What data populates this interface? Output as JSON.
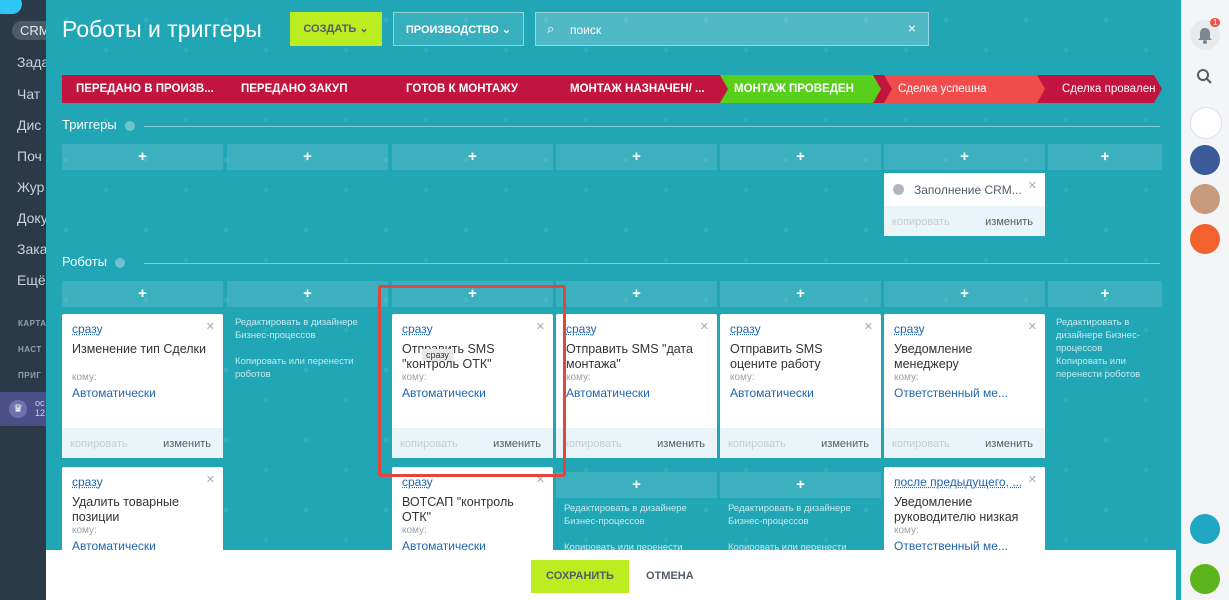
{
  "nav": {
    "pill": "CRM",
    "items": [
      "Зада",
      "Чат",
      "Дис",
      "Поч",
      "Жур",
      "Доку",
      "Зака",
      "Ещё"
    ],
    "small": [
      "КАРТА",
      "НАСТ",
      "ПРИГ"
    ],
    "user": {
      "line1": "ос",
      "line2": "12"
    }
  },
  "header": {
    "title": "Роботы и триггеры",
    "create_label": "СОЗДАТЬ",
    "pipeline_label": "ПРОИЗВОДСТВО",
    "search_placeholder": "поиск"
  },
  "stages": [
    {
      "label": "ПЕРЕДАНО В ПРОИЗВ...",
      "color": "#c1143f"
    },
    {
      "label": "ПЕРЕДАНО ЗАКУП",
      "color": "#c1143f"
    },
    {
      "label": "ГОТОВ К МОНТАЖУ",
      "color": "#c1143f"
    },
    {
      "label": "МОНТАЖ НАЗНАЧЕН/ ...",
      "color": "#c1143f"
    },
    {
      "label": "МОНТАЖ ПРОВЕДЕН",
      "color": "#c1143f"
    },
    {
      "label": "Сделка успешна",
      "color": "#58d01b"
    },
    {
      "label": "Сделка провален",
      "color": "#f14c4c"
    }
  ],
  "triggers": {
    "label": "Триггеры",
    "card": {
      "name": "Заполнение CRM...",
      "copy": "копировать",
      "edit": "изменить"
    }
  },
  "robots": {
    "label": "Роботы",
    "ghost": {
      "designer": "Редактировать в дизайнере Бизнес-процессов",
      "move": "Копировать или перенести роботов"
    },
    "cards": [
      {
        "timing": "сразу",
        "title": "Изменение тип Сделки",
        "komu": "кому:",
        "value": "Автоматически",
        "copy": "копировать",
        "edit": "изменить"
      },
      {
        "timing": "сразу",
        "title": "Отправить SMS \"контроль ОТК\"",
        "komu": "кому:",
        "value": "Автоматически",
        "copy": "копировать",
        "edit": "изменить"
      },
      {
        "timing": "сразу",
        "title": "Отправить SMS \"дата монтажа\"",
        "komu": "кому:",
        "value": "Автоматически",
        "copy": "копировать",
        "edit": "изменить"
      },
      {
        "timing": "сразу",
        "title": "Отправить SMS оцените работу",
        "komu": "кому:",
        "value": "Автоматически",
        "copy": "копировать",
        "edit": "изменить"
      },
      {
        "timing": "сразу",
        "title": "Уведомление менеджеру",
        "komu": "кому:",
        "value": "Ответственный ме...",
        "copy": "копировать",
        "edit": "изменить"
      },
      {
        "timing": "сразу",
        "title": "Удалить товарные позиции",
        "komu": "кому:",
        "value": "Автоматически",
        "copy": "",
        "edit": ""
      },
      {
        "timing": "сразу",
        "title": "ВОТСАП \"контроль ОТК\"",
        "komu": "кому:",
        "value": "Автоматически",
        "copy": "",
        "edit": ""
      },
      {
        "timing": "после предыдущего, ...",
        "title": "Уведомление руководителю низкая",
        "komu": "кому:",
        "value": "Ответственный ме...",
        "copy": "",
        "edit": ""
      }
    ],
    "tooltip": "сразу"
  },
  "footer": {
    "save_label": "СОХРАНИТЬ",
    "cancel_label": "ОТМЕНА"
  },
  "notifications": {
    "count": "1"
  }
}
